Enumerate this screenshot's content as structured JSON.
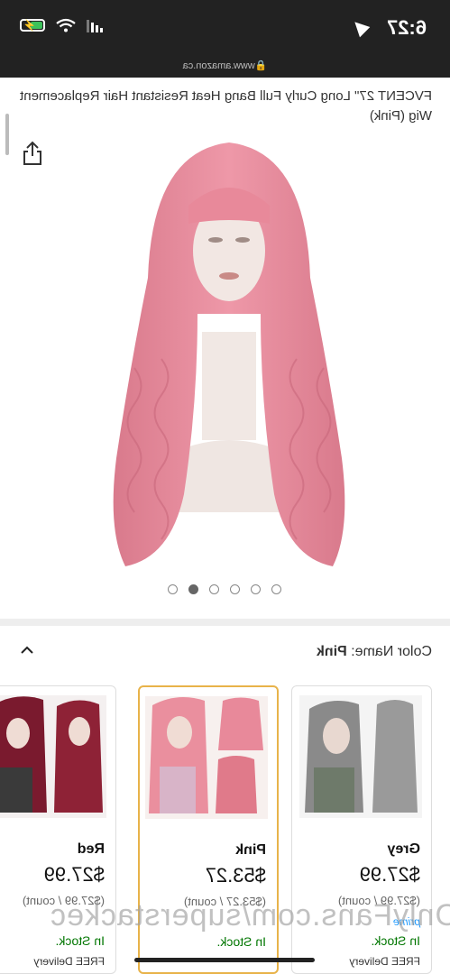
{
  "status_bar": {
    "time": "6:27",
    "signal_icon": "signal-bars-icon",
    "wifi_icon": "wifi-icon",
    "battery_icon": "battery-charging-icon"
  },
  "browser": {
    "url": "www.amazon.ca"
  },
  "product": {
    "title": "FVCENT 27\" Long Curly Full Bang Heat Resistant Hair Replacement Wig (Pink)",
    "image_dots_count": 6,
    "active_dot": 4
  },
  "variation": {
    "label": "Color Name:",
    "value": "Pink"
  },
  "swatches": [
    {
      "name": "Grey",
      "price": "$27.99",
      "unit": "($27.99 / count)",
      "prime": "prime",
      "stock": "In Stock.",
      "free": "FREE Delivery",
      "hair": "#9a9a9a",
      "hair_dark": "#6f6f6f"
    },
    {
      "name": "Pink",
      "price": "$53.27",
      "unit": "($53.27 / count)",
      "prime": "",
      "stock": "In Stock.",
      "free": "",
      "hair": "#e8899a",
      "hair_dark": "#d06c7e"
    },
    {
      "name": "Red",
      "price": "$27.99",
      "unit": "($27.99 / count)",
      "prime": "",
      "stock": "In Stock.",
      "free": "FREE Delivery",
      "hair": "#8e2236",
      "hair_dark": "#6a1627"
    }
  ],
  "watermark": "OnlyFans.com/superstackec",
  "colors": {
    "status_bg": "#222222",
    "selected_border": "#e8b34a",
    "in_stock": "#007600",
    "prime": "#1a98ff",
    "wig_pink": "#e8899a"
  }
}
